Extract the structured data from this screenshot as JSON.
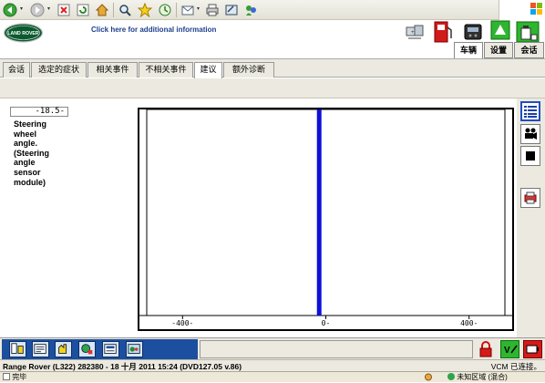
{
  "browser": {
    "toolbar_icons": [
      "back-icon",
      "forward-icon",
      "stop-icon",
      "refresh-icon",
      "home-icon",
      "search-icon",
      "favorites-icon",
      "history-icon",
      "mail-icon",
      "print-icon",
      "edit-icon",
      "messenger-icon"
    ]
  },
  "header": {
    "info_link": "Click here for additional information",
    "logo_text": "LAND ROVER",
    "tabs": [
      "车辆",
      "设置",
      "会话"
    ]
  },
  "subtabs": [
    "会话",
    "选定的症状",
    "相关事件",
    "不相关事件",
    "建议",
    "额外诊断"
  ],
  "active_subtab": "建议",
  "parameter": {
    "readout": "-18.5-",
    "label": "Steering\nwheel\nangle.\n(Steering\nangle\nsensor\nmodule)"
  },
  "chart_data": {
    "type": "bar",
    "orientation": "horizontal-indicator",
    "x_ticks": [
      "-400-",
      "0-",
      "400-"
    ],
    "xlim": [
      -500,
      500
    ],
    "value": -18.5,
    "bar_color": "#1010d8"
  },
  "tools": [
    "list-icon",
    "camera-icon",
    "stop-icon",
    "printer-icon"
  ],
  "bottom_icons": [
    "tool-1-icon",
    "tool-2-icon",
    "tool-3-icon",
    "tool-4-icon",
    "tool-5-icon",
    "tool-6-icon"
  ],
  "vehicle_info": "Range Rover (L322) 282380 - 18 十月  2011 15:24 (DVD127.05 v.86)",
  "vcm_status": "VCM 已连接。",
  "statusbar": {
    "done": "完毕",
    "zone": "未知区域 (混合)"
  }
}
